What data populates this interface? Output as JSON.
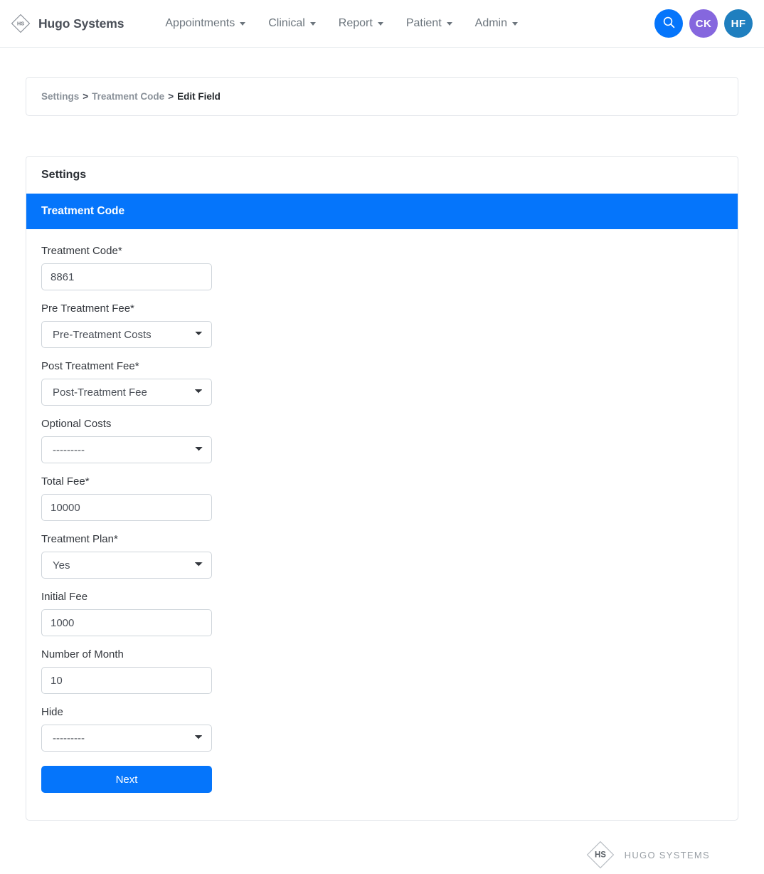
{
  "navbar": {
    "brand": {
      "name": "Hugo Systems",
      "mark_text": "HS",
      "mark_icon": "diamond-logo-icon"
    },
    "items": [
      {
        "label": "Appointments",
        "icon": "chevron-down-icon"
      },
      {
        "label": "Clinical",
        "icon": "chevron-down-icon"
      },
      {
        "label": "Report",
        "icon": "chevron-down-icon"
      },
      {
        "label": "Patient",
        "icon": "chevron-down-icon"
      },
      {
        "label": "Admin",
        "icon": "chevron-down-icon"
      }
    ],
    "actions": {
      "search": {
        "icon": "search-icon",
        "label": "",
        "color": "#0575fb"
      },
      "avatar_1": {
        "label": "CK",
        "color": "#8567de"
      },
      "avatar_2": {
        "label": "HF",
        "color": "#1f7fbf"
      }
    }
  },
  "breadcrumb": {
    "root": "Settings",
    "separator": ">",
    "parent": "Treatment Code",
    "current": "Edit Field"
  },
  "card": {
    "title": "Settings",
    "section_title": "Treatment Code"
  },
  "form": {
    "fields": [
      {
        "label": "Treatment Code*",
        "type": "text",
        "value": "8861",
        "name": "treatment-code"
      },
      {
        "label": "Pre Treatment Fee*",
        "type": "select",
        "value": "Pre-Treatment Costs",
        "name": "pre-treatment-fee"
      },
      {
        "label": "Post Treatment Fee*",
        "type": "select",
        "value": "Post-Treatment Fee",
        "name": "post-treatment-fee"
      },
      {
        "label": "Optional Costs",
        "type": "select",
        "value": "---------",
        "name": "optional-costs"
      },
      {
        "label": "Total Fee*",
        "type": "text",
        "value": "10000",
        "name": "total-fee"
      },
      {
        "label": "Treatment Plan*",
        "type": "select",
        "value": "Yes",
        "name": "treatment-plan"
      },
      {
        "label": "Initial Fee",
        "type": "text",
        "value": "1000",
        "name": "initial-fee"
      },
      {
        "label": "Number of Month",
        "type": "text",
        "value": "10",
        "name": "number-of-month"
      },
      {
        "label": "Hide",
        "type": "select",
        "value": "---------",
        "name": "hide"
      }
    ],
    "submit_label": "Next"
  },
  "footer": {
    "mark_text": "HS",
    "text": "HUGO SYSTEMS"
  },
  "colors": {
    "accent": "#0575fb",
    "nav_text": "#6c757d",
    "border": "#ced4da"
  }
}
